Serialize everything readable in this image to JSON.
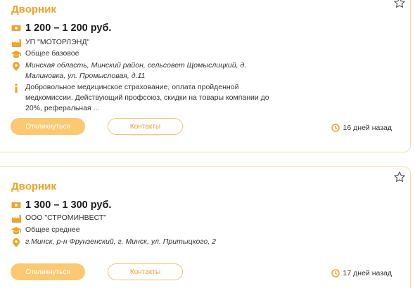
{
  "vacancies": [
    {
      "title": "Дворник",
      "salary": "1 200 – 1 200 руб.",
      "company": "УП \"МОТОРЛЭНД\"",
      "education": "Общее базовое",
      "address": "Минская область, Минский район, сельсовет Щомыслицкий, д. Малиновка, ул. Промысловая, д.11",
      "description": "Добровольное медицинское страхование, оплата пройденной медкомиссии. Действующий профсоюз, скидки на товары компании до 20%, реферальная ...",
      "respond_label": "Откликнуться",
      "contacts_label": "Контакты",
      "posted": "16 дней назад"
    },
    {
      "title": "Дворник",
      "salary": "1 300 – 1 300 руб.",
      "company": "ООО \"СТРОМИНВЕСТ\"",
      "education": "Общее среднее",
      "address": "г.Минск, р-н Фрунзенский, г. Минск, ул. Притыцкого, 2",
      "respond_label": "Откликнуться",
      "contacts_label": "Контакты",
      "posted": "17 дней назад"
    }
  ],
  "colors": {
    "accent": "#f0a428",
    "button_fill": "#fbc971",
    "card_border": "#f3d9a8"
  },
  "icons": [
    "money-icon",
    "factory-icon",
    "graduation-cap-icon",
    "location-pin-icon",
    "info-icon",
    "clock-icon",
    "star-icon"
  ]
}
